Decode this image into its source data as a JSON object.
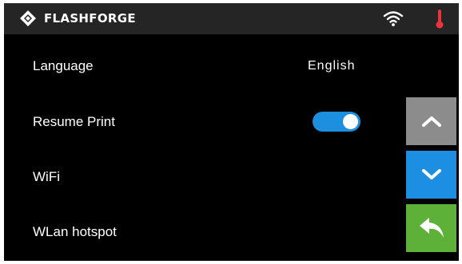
{
  "header": {
    "brand_name": "FLASHFORGE",
    "icons": [
      "flashforge-logo-icon",
      "wifi-icon",
      "thermometer-icon"
    ],
    "thermometer_color": "#e8343a"
  },
  "settings": {
    "rows": [
      {
        "label": "Language",
        "value": "English"
      },
      {
        "label": "Resume Print",
        "toggle_on": true
      },
      {
        "label": "WiFi"
      },
      {
        "label": "WLan hotspot"
      }
    ]
  },
  "side_buttons": {
    "up": {
      "icon": "chevron-up-icon",
      "color": "#8c8c8c"
    },
    "down": {
      "icon": "chevron-down-icon",
      "color": "#1c8fe3"
    },
    "back": {
      "icon": "back-arrow-icon",
      "color": "#5db139"
    }
  },
  "colors": {
    "background": "#000000",
    "topbar": "#252526",
    "toggle_on": "#1d8fdf"
  }
}
